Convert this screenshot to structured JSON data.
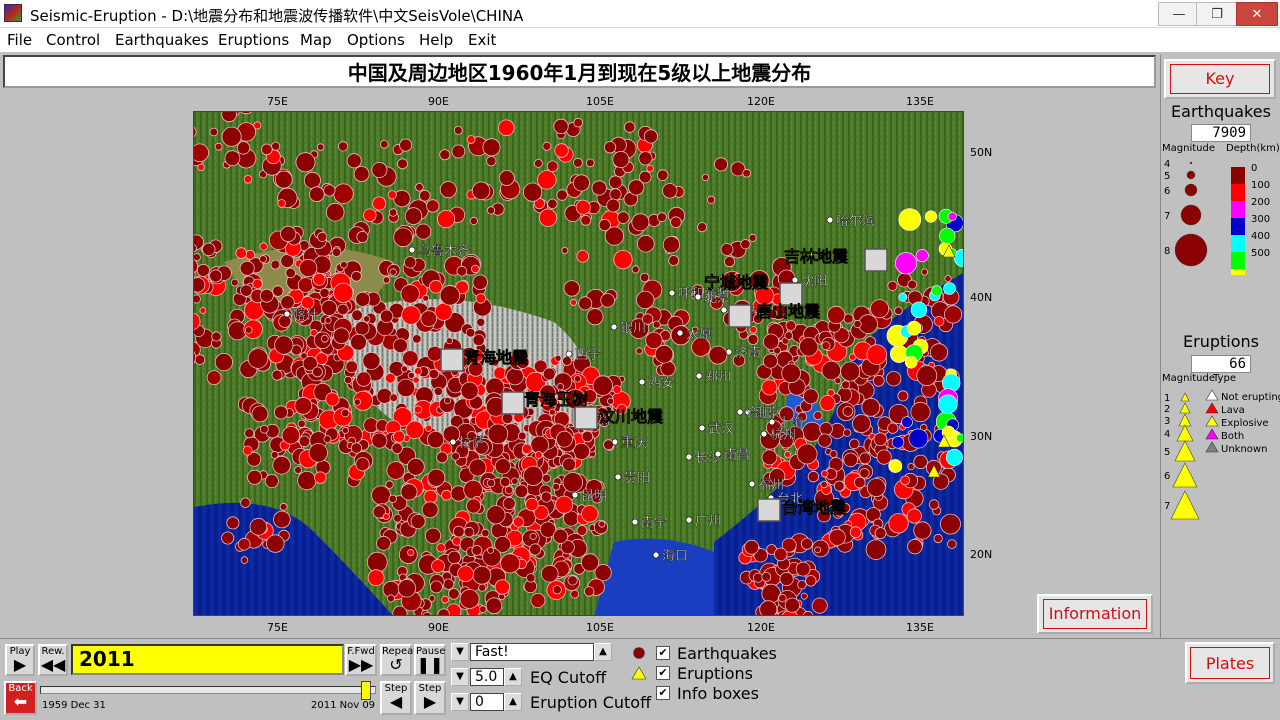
{
  "window": {
    "title": "Seismic-Eruption - D:\\地震分布和地震波传播软件\\中文SeisVole\\CHINA",
    "minimize_glyph": "—",
    "maximize_glyph": "❐",
    "close_glyph": "✕"
  },
  "menu": [
    "File",
    "Control",
    "Earthquakes",
    "Eruptions",
    "Map",
    "Options",
    "Help",
    "Exit"
  ],
  "header": {
    "title": "中国及周边地区1960年1月到现在5级以上地震分布"
  },
  "map": {
    "top_axis": [
      "75E",
      "90E",
      "105E",
      "120E",
      "135E"
    ],
    "bottom_axis": [
      "75E",
      "90E",
      "105E",
      "120E",
      "135E"
    ],
    "right_axis": [
      "50N",
      "40N",
      "30N",
      "20N"
    ],
    "cities": [
      {
        "name": "哈尔滨"
      },
      {
        "name": "乌鲁木齐"
      },
      {
        "name": "沈阳"
      },
      {
        "name": "呼和浩特"
      },
      {
        "name": "北京"
      },
      {
        "name": "天津"
      },
      {
        "name": "喀什"
      },
      {
        "name": "银川"
      },
      {
        "name": "太原"
      },
      {
        "name": "西宁"
      },
      {
        "name": "济南"
      },
      {
        "name": "西安"
      },
      {
        "name": "郑州"
      },
      {
        "name": "南京"
      },
      {
        "name": "合肥"
      },
      {
        "name": "成都"
      },
      {
        "name": "武汉"
      },
      {
        "name": "上海"
      },
      {
        "name": "杭州"
      },
      {
        "name": "拉萨"
      },
      {
        "name": "重庆"
      },
      {
        "name": "长沙"
      },
      {
        "name": "南昌"
      },
      {
        "name": "贵阳"
      },
      {
        "name": "福州"
      },
      {
        "name": "昆明"
      },
      {
        "name": "台北"
      },
      {
        "name": "南宁"
      },
      {
        "name": "广州"
      },
      {
        "name": "海口"
      }
    ],
    "events": [
      {
        "name": "吉林地震"
      },
      {
        "name": "宁城地震"
      },
      {
        "name": "唐山地震"
      },
      {
        "name": "青海地震"
      },
      {
        "name": "青海玉树"
      },
      {
        "name": "汶川地震"
      },
      {
        "name": "台湾地震"
      }
    ]
  },
  "side": {
    "key_label": "Key",
    "eq_title": "Earthquakes",
    "eq_count": "7909",
    "magnitude_label": "Magnitude",
    "depth_label": "Depth(km)",
    "eq_mags": [
      "4",
      "5",
      "6",
      "7",
      "8"
    ],
    "depth_levels": [
      {
        "value": "0",
        "color": "#8b0000"
      },
      {
        "value": "100",
        "color": "#ff0000"
      },
      {
        "value": "200",
        "color": "#ff00ff"
      },
      {
        "value": "300",
        "color": "#0000cc"
      },
      {
        "value": "400",
        "color": "#00ffff"
      },
      {
        "value": "500",
        "color": "#00ff00"
      },
      {
        "value": "",
        "color": "#ffff00"
      }
    ],
    "er_title": "Eruptions",
    "er_count": "66",
    "er_mag_label": "Magnitude",
    "er_type_label": "Type",
    "er_mags": [
      "1",
      "2",
      "3",
      "4",
      "5",
      "6",
      "7"
    ],
    "er_types": [
      {
        "label": "Not erupting",
        "color": "#ffffff"
      },
      {
        "label": "Lava",
        "color": "#ff0000"
      },
      {
        "label": "Explosive",
        "color": "#ffff00"
      },
      {
        "label": "Both",
        "color": "#ff00ff"
      },
      {
        "label": "Unknown",
        "color": "#808080"
      }
    ],
    "information_label": "Information",
    "plates_label": "Plates"
  },
  "controls": {
    "play": "Play",
    "rew": "Rew.",
    "ffwd": "F.Fwd",
    "repeat": "Repeat",
    "pause": "Pause",
    "back": "Back",
    "step1": "Step",
    "step2": "Step",
    "year": "2011",
    "start_date": "1959 Dec 31",
    "end_date": "2011 Nov 09",
    "speed": "Fast!",
    "eq_cutoff_value": "5.0",
    "eq_cutoff_label": "EQ Cutoff",
    "er_cutoff_value": "0",
    "er_cutoff_label": "Eruption Cutoff",
    "chk_earthquakes": "Earthquakes",
    "chk_eruptions": "Eruptions",
    "chk_info": "Info boxes",
    "check_glyph": "✔",
    "slider_position": 0.97
  },
  "colors": {
    "quake": "#8b0000",
    "year_bg": "#ffff00",
    "accent_red": "#d01010"
  }
}
